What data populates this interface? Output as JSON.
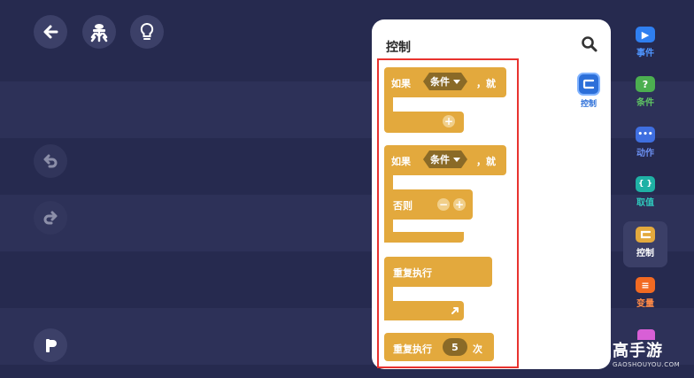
{
  "panel": {
    "title": "控制",
    "side_category": "控制"
  },
  "blocks": {
    "if1": {
      "if_label": "如果",
      "condition": "条件",
      "then_label": "，就"
    },
    "if2": {
      "if_label": "如果",
      "condition": "条件",
      "then_label": "，就",
      "else_label": "否则"
    },
    "repeat": {
      "label": "重复执行"
    },
    "repeat_n": {
      "label": "重复执行",
      "count": "5",
      "unit": "次"
    }
  },
  "categories": [
    {
      "label": "事件",
      "color": "#2f7ff0",
      "glyph": "▶"
    },
    {
      "label": "条件",
      "color": "#4caf50",
      "glyph": "?"
    },
    {
      "label": "动作",
      "color": "#3f6fe0",
      "glyph": "•••"
    },
    {
      "label": "取值",
      "color": "#1fb1a5",
      "glyph": "{ }"
    },
    {
      "label": "控制",
      "color": "#e3a93d",
      "glyph": ""
    },
    {
      "label": "变量",
      "color": "#f26a22",
      "glyph": "≡"
    }
  ],
  "watermark": {
    "brand": "高手游",
    "domain": "GAOSHOUYOU.COM"
  },
  "colors": {
    "background": "#262a4f",
    "block": "#e3a93d",
    "highlight": "#e8332f"
  }
}
